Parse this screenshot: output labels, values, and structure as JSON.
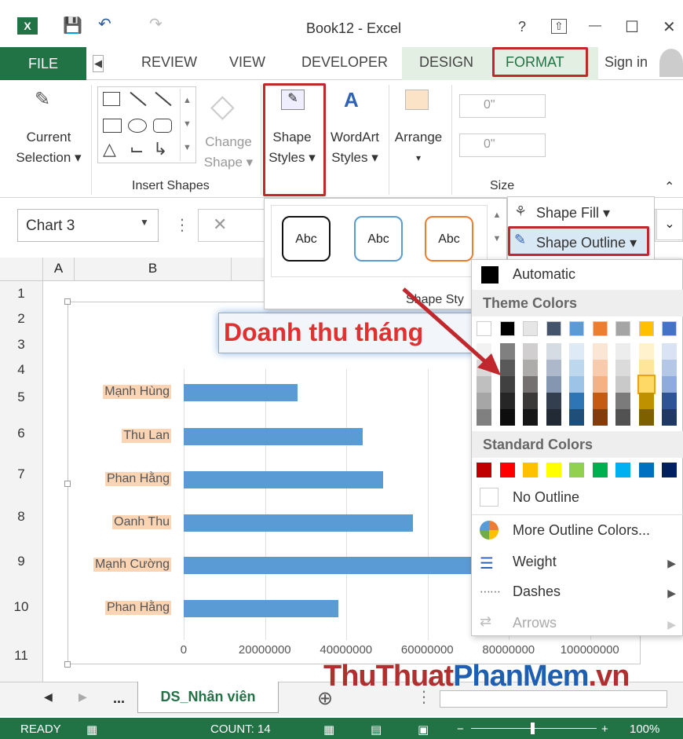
{
  "window": {
    "title": "Book12 - Excel",
    "app_icon": "excel-icon",
    "help": "?",
    "minimize": "—",
    "maximize": "☐",
    "close": "✕"
  },
  "tabs": {
    "file": "FILE",
    "items": [
      "REVIEW",
      "VIEW",
      "DEVELOPER",
      "DESIGN",
      "FORMAT"
    ],
    "sign_in": "Sign in"
  },
  "ribbon": {
    "current_selection": [
      "Current",
      "Selection ▾"
    ],
    "insert_shapes": "Insert Shapes",
    "change_shape": [
      "Change",
      "Shape ▾"
    ],
    "shape_styles": [
      "Shape",
      "Styles ▾"
    ],
    "wordart_styles": [
      "WordArt",
      "Styles ▾"
    ],
    "arrange": [
      "Arrange",
      "▾"
    ],
    "size": "Size",
    "height": "0\"",
    "width": "0\""
  },
  "name_box": "Chart 3",
  "columns": [
    "A",
    "B"
  ],
  "rows": [
    "1",
    "2",
    "3",
    "4",
    "5",
    "6",
    "7",
    "8",
    "9",
    "10",
    "11"
  ],
  "styles_popup": {
    "samples": [
      "Abc",
      "Abc",
      "Abc"
    ],
    "group_label": "Shape Sty"
  },
  "shape_fill": "Shape Fill ▾",
  "shape_outline": "Shape Outline ▾",
  "outline_menu": {
    "automatic": "Automatic",
    "theme_colors": "Theme Colors",
    "standard_colors": "Standard Colors",
    "no_outline": "No Outline",
    "more_colors": "More Outline Colors...",
    "weight": "Weight",
    "dashes": "Dashes",
    "arrows": "Arrows",
    "theme_top": [
      "#ffffff",
      "#000000",
      "#e7e6e6",
      "#44546a",
      "#5b9bd5",
      "#ed7d31",
      "#a5a5a5",
      "#ffc000",
      "#4472c4",
      "#70ad47"
    ],
    "theme_shades": [
      [
        "#f2f2f2",
        "#d9d9d9",
        "#bfbfbf",
        "#a6a6a6",
        "#808080"
      ],
      [
        "#808080",
        "#595959",
        "#404040",
        "#262626",
        "#0d0d0d"
      ],
      [
        "#d0cece",
        "#aeabab",
        "#757171",
        "#3b3838",
        "#161616"
      ],
      [
        "#d6dce4",
        "#adb9ca",
        "#8496b0",
        "#333f4f",
        "#222a35"
      ],
      [
        "#deebf6",
        "#bdd7ee",
        "#9dc3e6",
        "#2e75b5",
        "#1f4e79"
      ],
      [
        "#fbe5d5",
        "#f7cbac",
        "#f4b183",
        "#c55a11",
        "#833c0b"
      ],
      [
        "#ededed",
        "#dbdbdb",
        "#c9c9c9",
        "#7b7b7b",
        "#525252"
      ],
      [
        "#fff2cc",
        "#fee599",
        "#ffd965",
        "#bf9000",
        "#7f6000"
      ],
      [
        "#dae3f3",
        "#b4c7e7",
        "#8faadc",
        "#2f5496",
        "#1f3864"
      ],
      [
        "#e2efd9",
        "#c5e0b3",
        "#a8d08d",
        "#538135",
        "#375623"
      ]
    ],
    "standard": [
      "#c00000",
      "#ff0000",
      "#ffc000",
      "#ffff00",
      "#92d050",
      "#00b050",
      "#00b0f0",
      "#0070c0",
      "#002060",
      "#7030a0"
    ]
  },
  "chart_data": {
    "type": "bar",
    "title": "Doanh thu tháng",
    "categories": [
      "Mạnh Hùng",
      "Thu Lan",
      "Phan Hằng",
      "Oanh Thu",
      "Mạnh Cường",
      "Phan Hằng"
    ],
    "values": [
      28000000,
      44000000,
      49000000,
      56500000,
      73000000,
      38000000
    ],
    "xticks": [
      "0",
      "20000000",
      "40000000",
      "60000000",
      "80000000",
      "100000000"
    ],
    "xlim": [
      0,
      100000000
    ],
    "bar_color": "#5b9bd5"
  },
  "sheet": {
    "tab": "DS_Nhân viên",
    "more": "...",
    "add": "⊕"
  },
  "status": {
    "ready": "READY",
    "count": "COUNT: 14",
    "zoom": "100%"
  },
  "watermark": {
    "a": "ThuThuat",
    "b": "PhanMem",
    "c": ".vn"
  }
}
